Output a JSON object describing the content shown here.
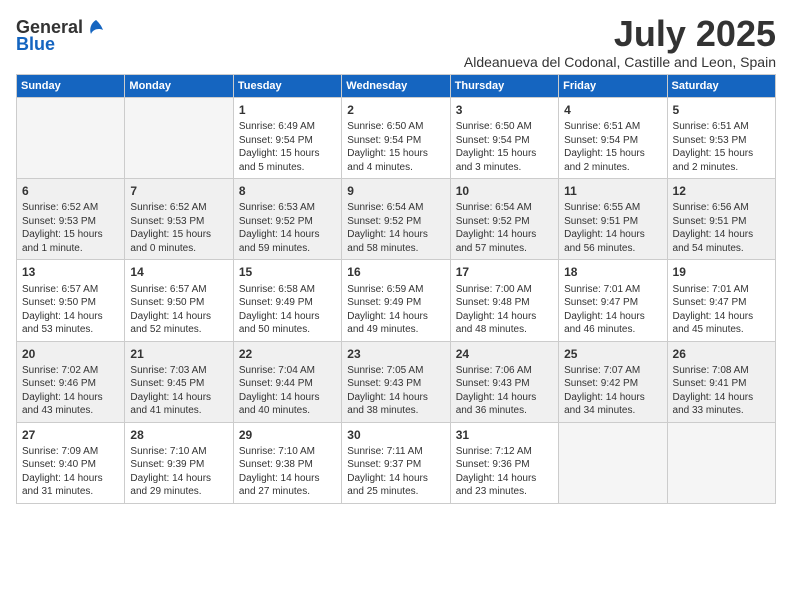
{
  "logo": {
    "general": "General",
    "blue": "Blue"
  },
  "header": {
    "month": "July 2025",
    "location": "Aldeanueva del Codonal, Castille and Leon, Spain"
  },
  "weekdays": [
    "Sunday",
    "Monday",
    "Tuesday",
    "Wednesday",
    "Thursday",
    "Friday",
    "Saturday"
  ],
  "weeks": [
    [
      {
        "day": "",
        "empty": true
      },
      {
        "day": "",
        "empty": true
      },
      {
        "day": "1",
        "sunrise": "Sunrise: 6:49 AM",
        "sunset": "Sunset: 9:54 PM",
        "daylight": "Daylight: 15 hours and 5 minutes."
      },
      {
        "day": "2",
        "sunrise": "Sunrise: 6:50 AM",
        "sunset": "Sunset: 9:54 PM",
        "daylight": "Daylight: 15 hours and 4 minutes."
      },
      {
        "day": "3",
        "sunrise": "Sunrise: 6:50 AM",
        "sunset": "Sunset: 9:54 PM",
        "daylight": "Daylight: 15 hours and 3 minutes."
      },
      {
        "day": "4",
        "sunrise": "Sunrise: 6:51 AM",
        "sunset": "Sunset: 9:54 PM",
        "daylight": "Daylight: 15 hours and 2 minutes."
      },
      {
        "day": "5",
        "sunrise": "Sunrise: 6:51 AM",
        "sunset": "Sunset: 9:53 PM",
        "daylight": "Daylight: 15 hours and 2 minutes."
      }
    ],
    [
      {
        "day": "6",
        "sunrise": "Sunrise: 6:52 AM",
        "sunset": "Sunset: 9:53 PM",
        "daylight": "Daylight: 15 hours and 1 minute."
      },
      {
        "day": "7",
        "sunrise": "Sunrise: 6:52 AM",
        "sunset": "Sunset: 9:53 PM",
        "daylight": "Daylight: 15 hours and 0 minutes."
      },
      {
        "day": "8",
        "sunrise": "Sunrise: 6:53 AM",
        "sunset": "Sunset: 9:52 PM",
        "daylight": "Daylight: 14 hours and 59 minutes."
      },
      {
        "day": "9",
        "sunrise": "Sunrise: 6:54 AM",
        "sunset": "Sunset: 9:52 PM",
        "daylight": "Daylight: 14 hours and 58 minutes."
      },
      {
        "day": "10",
        "sunrise": "Sunrise: 6:54 AM",
        "sunset": "Sunset: 9:52 PM",
        "daylight": "Daylight: 14 hours and 57 minutes."
      },
      {
        "day": "11",
        "sunrise": "Sunrise: 6:55 AM",
        "sunset": "Sunset: 9:51 PM",
        "daylight": "Daylight: 14 hours and 56 minutes."
      },
      {
        "day": "12",
        "sunrise": "Sunrise: 6:56 AM",
        "sunset": "Sunset: 9:51 PM",
        "daylight": "Daylight: 14 hours and 54 minutes."
      }
    ],
    [
      {
        "day": "13",
        "sunrise": "Sunrise: 6:57 AM",
        "sunset": "Sunset: 9:50 PM",
        "daylight": "Daylight: 14 hours and 53 minutes."
      },
      {
        "day": "14",
        "sunrise": "Sunrise: 6:57 AM",
        "sunset": "Sunset: 9:50 PM",
        "daylight": "Daylight: 14 hours and 52 minutes."
      },
      {
        "day": "15",
        "sunrise": "Sunrise: 6:58 AM",
        "sunset": "Sunset: 9:49 PM",
        "daylight": "Daylight: 14 hours and 50 minutes."
      },
      {
        "day": "16",
        "sunrise": "Sunrise: 6:59 AM",
        "sunset": "Sunset: 9:49 PM",
        "daylight": "Daylight: 14 hours and 49 minutes."
      },
      {
        "day": "17",
        "sunrise": "Sunrise: 7:00 AM",
        "sunset": "Sunset: 9:48 PM",
        "daylight": "Daylight: 14 hours and 48 minutes."
      },
      {
        "day": "18",
        "sunrise": "Sunrise: 7:01 AM",
        "sunset": "Sunset: 9:47 PM",
        "daylight": "Daylight: 14 hours and 46 minutes."
      },
      {
        "day": "19",
        "sunrise": "Sunrise: 7:01 AM",
        "sunset": "Sunset: 9:47 PM",
        "daylight": "Daylight: 14 hours and 45 minutes."
      }
    ],
    [
      {
        "day": "20",
        "sunrise": "Sunrise: 7:02 AM",
        "sunset": "Sunset: 9:46 PM",
        "daylight": "Daylight: 14 hours and 43 minutes."
      },
      {
        "day": "21",
        "sunrise": "Sunrise: 7:03 AM",
        "sunset": "Sunset: 9:45 PM",
        "daylight": "Daylight: 14 hours and 41 minutes."
      },
      {
        "day": "22",
        "sunrise": "Sunrise: 7:04 AM",
        "sunset": "Sunset: 9:44 PM",
        "daylight": "Daylight: 14 hours and 40 minutes."
      },
      {
        "day": "23",
        "sunrise": "Sunrise: 7:05 AM",
        "sunset": "Sunset: 9:43 PM",
        "daylight": "Daylight: 14 hours and 38 minutes."
      },
      {
        "day": "24",
        "sunrise": "Sunrise: 7:06 AM",
        "sunset": "Sunset: 9:43 PM",
        "daylight": "Daylight: 14 hours and 36 minutes."
      },
      {
        "day": "25",
        "sunrise": "Sunrise: 7:07 AM",
        "sunset": "Sunset: 9:42 PM",
        "daylight": "Daylight: 14 hours and 34 minutes."
      },
      {
        "day": "26",
        "sunrise": "Sunrise: 7:08 AM",
        "sunset": "Sunset: 9:41 PM",
        "daylight": "Daylight: 14 hours and 33 minutes."
      }
    ],
    [
      {
        "day": "27",
        "sunrise": "Sunrise: 7:09 AM",
        "sunset": "Sunset: 9:40 PM",
        "daylight": "Daylight: 14 hours and 31 minutes."
      },
      {
        "day": "28",
        "sunrise": "Sunrise: 7:10 AM",
        "sunset": "Sunset: 9:39 PM",
        "daylight": "Daylight: 14 hours and 29 minutes."
      },
      {
        "day": "29",
        "sunrise": "Sunrise: 7:10 AM",
        "sunset": "Sunset: 9:38 PM",
        "daylight": "Daylight: 14 hours and 27 minutes."
      },
      {
        "day": "30",
        "sunrise": "Sunrise: 7:11 AM",
        "sunset": "Sunset: 9:37 PM",
        "daylight": "Daylight: 14 hours and 25 minutes."
      },
      {
        "day": "31",
        "sunrise": "Sunrise: 7:12 AM",
        "sunset": "Sunset: 9:36 PM",
        "daylight": "Daylight: 14 hours and 23 minutes."
      },
      {
        "day": "",
        "empty": true
      },
      {
        "day": "",
        "empty": true
      }
    ]
  ]
}
